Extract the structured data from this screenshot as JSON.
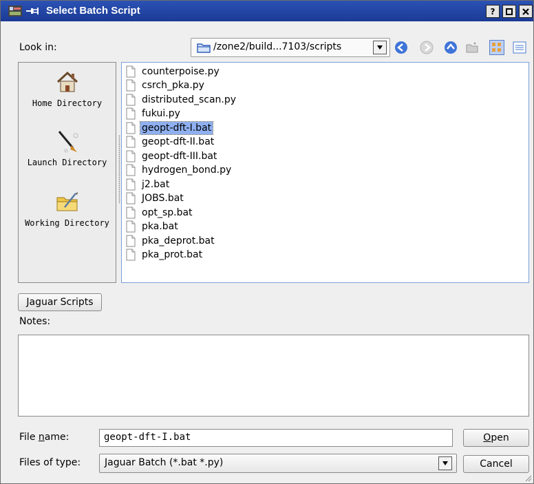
{
  "window": {
    "title": "Select Batch Script",
    "buttons": {
      "help": "?",
      "maximize": "□",
      "close": "×"
    }
  },
  "look_in": {
    "label": "Look in:",
    "path": "/zone2/build...7103/scripts"
  },
  "toolbar_icons": [
    "back-icon",
    "forward-icon",
    "up-icon",
    "new-folder-icon",
    "icon-view-icon",
    "detail-view-icon"
  ],
  "sidebar": {
    "items": [
      {
        "label": "Home Directory",
        "icon": "home-icon"
      },
      {
        "label": "Launch Directory",
        "icon": "launch-icon"
      },
      {
        "label": "Working Directory",
        "icon": "working-directory-icon"
      }
    ]
  },
  "files": [
    {
      "name": "counterpoise.py",
      "selected": false
    },
    {
      "name": "csrch_pka.py",
      "selected": false
    },
    {
      "name": "distributed_scan.py",
      "selected": false
    },
    {
      "name": "fukui.py",
      "selected": false
    },
    {
      "name": "geopt-dft-I.bat",
      "selected": true
    },
    {
      "name": "geopt-dft-II.bat",
      "selected": false
    },
    {
      "name": "geopt-dft-III.bat",
      "selected": false
    },
    {
      "name": "hydrogen_bond.py",
      "selected": false
    },
    {
      "name": "j2.bat",
      "selected": false
    },
    {
      "name": "JOBS.bat",
      "selected": false
    },
    {
      "name": "opt_sp.bat",
      "selected": false
    },
    {
      "name": "pka.bat",
      "selected": false
    },
    {
      "name": "pka_deprot.bat",
      "selected": false
    },
    {
      "name": "pka_prot.bat",
      "selected": false
    }
  ],
  "jaguar_scripts_button": "Jaguar Scripts",
  "notes_label": "Notes:",
  "file_name": {
    "label_prefix": "File ",
    "label_mnemonic": "n",
    "label_suffix": "ame:",
    "value": "geopt-dft-I.bat"
  },
  "files_of_type": {
    "label": "Files of type:",
    "value": "Jaguar Batch (*.bat *.py)"
  },
  "open_button": {
    "mnemonic": "O",
    "rest": "pen"
  },
  "cancel_button": "Cancel",
  "colors": {
    "titlebar": "#2b52b5",
    "selection": "#8fb0f0",
    "list_border": "#7aa0d9"
  }
}
